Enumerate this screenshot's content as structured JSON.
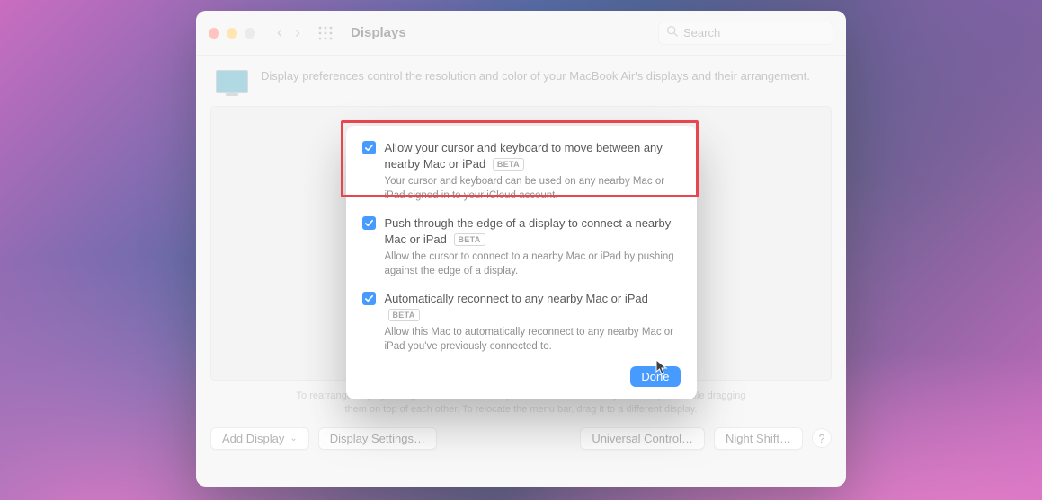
{
  "window": {
    "title": "Displays",
    "search_placeholder": "Search",
    "intro": "Display preferences control the resolution and color of your MacBook Air's displays and their arrangement.",
    "hints_line1": "To rearrange displays, drag them to the desired position. To mirror displays, hold Option while dragging",
    "hints_line2": "them on top of each other. To relocate the menu bar, drag it to a different display."
  },
  "toolbar": {
    "add_display": "Add Display",
    "display_settings": "Display Settings…",
    "universal_control": "Universal Control…",
    "night_shift": "Night Shift…",
    "help": "?"
  },
  "sheet": {
    "beta_label": "BETA",
    "options": [
      {
        "title": "Allow your cursor and keyboard to move between any nearby Mac or iPad",
        "desc": "Your cursor and keyboard can be used on any nearby Mac or iPad signed in to your iCloud account.",
        "checked": true
      },
      {
        "title": "Push through the edge of a display to connect a nearby Mac or iPad",
        "desc": "Allow the cursor to connect to a nearby Mac or iPad by pushing against the edge of a display.",
        "checked": true
      },
      {
        "title": "Automatically reconnect to any nearby Mac or iPad",
        "desc": "Allow this Mac to automatically reconnect to any nearby Mac or iPad you've previously connected to.",
        "checked": true
      }
    ],
    "done": "Done"
  }
}
